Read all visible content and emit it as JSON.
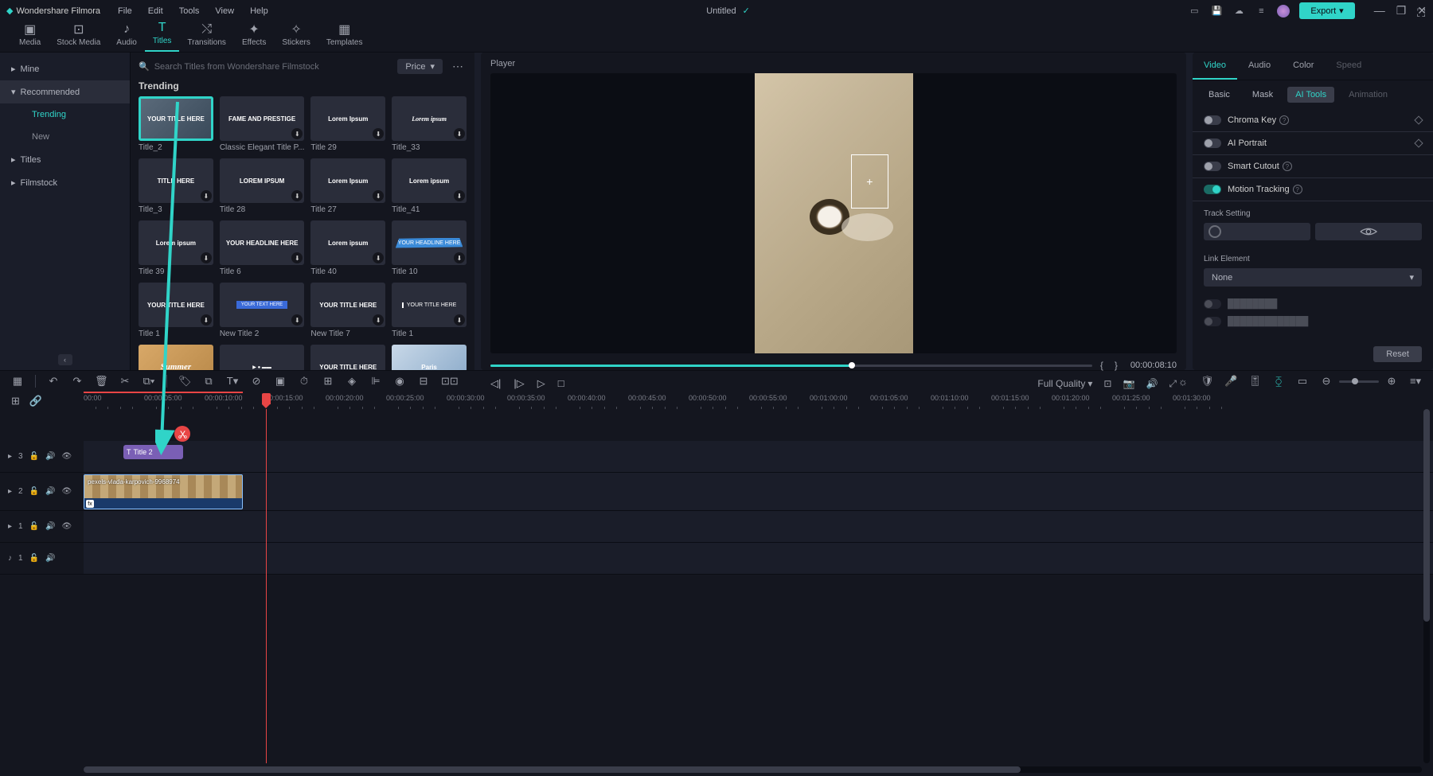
{
  "titlebar": {
    "brand": "Wondershare Filmora",
    "menus": [
      "File",
      "Edit",
      "Tools",
      "View",
      "Help"
    ],
    "document": "Untitled",
    "export": "Export"
  },
  "topnav": [
    "Media",
    "Stock Media",
    "Audio",
    "Titles",
    "Transitions",
    "Effects",
    "Stickers",
    "Templates"
  ],
  "topnav_active": 3,
  "sidebar": {
    "items": [
      {
        "label": "Mine",
        "type": "collapsible"
      },
      {
        "label": "Recommended",
        "type": "header"
      },
      {
        "label": "Trending",
        "type": "child",
        "active": true
      },
      {
        "label": "New",
        "type": "child"
      },
      {
        "label": "Titles",
        "type": "collapsible"
      },
      {
        "label": "Filmstock",
        "type": "collapsible"
      }
    ]
  },
  "browser": {
    "search_placeholder": "Search Titles from Wondershare Filmstock",
    "sort": "Price",
    "heading": "Trending",
    "cards": [
      {
        "thumb_text": "YOUR TITLE HERE",
        "label": "Title_2",
        "selected": true,
        "dark": false
      },
      {
        "thumb_text": "FAME AND PRESTIGE",
        "label": "Classic Elegant Title P...",
        "dark": true
      },
      {
        "thumb_text": "Lorem Ipsum",
        "label": "Title 29",
        "dark": true
      },
      {
        "thumb_text": "Lorem ipsum",
        "label": "Title_33",
        "dark": true,
        "italic": true
      },
      {
        "thumb_text": "TITLE HERE",
        "label": "Title_3",
        "dark": true
      },
      {
        "thumb_text": "LOREM IPSUM",
        "label": "Title 28",
        "dark": true
      },
      {
        "thumb_text": "Lorem Ipsum",
        "label": "Title 27",
        "dark": true
      },
      {
        "thumb_text": "Lorem ipsum",
        "label": "Title_41",
        "dark": true
      },
      {
        "thumb_text": "Lorem ipsum",
        "label": "Title 39",
        "dark": true
      },
      {
        "thumb_text": "YOUR HEADLINE HERE",
        "label": "Title 6",
        "dark": true,
        "align": "left"
      },
      {
        "thumb_text": "Lorem ipsum",
        "label": "Title 40",
        "dark": true
      },
      {
        "thumb_text": "YOUR HEADLINE HERE",
        "label": "Title 10",
        "dark": true,
        "splash": true
      },
      {
        "thumb_text": "YOUR TITLE HERE",
        "label": "Title 1",
        "dark": true
      },
      {
        "thumb_text": "YOUR TEXT HERE",
        "label": "New Title 2",
        "dark": true,
        "blue": true
      },
      {
        "thumb_text": "YOUR TITLE HERE",
        "label": "New Title 7",
        "dark": true
      },
      {
        "thumb_text": "YOUR TITLE HERE",
        "label": "Title 1",
        "dark": true,
        "bar": true
      },
      {
        "thumb_text": "Summer",
        "label": "",
        "dark": false,
        "script": true
      },
      {
        "thumb_text": "",
        "label": "",
        "dark": true,
        "youtube": true
      },
      {
        "thumb_text": "YOUR TITLE HERE",
        "label": "",
        "dark": true
      },
      {
        "thumb_text": "Paris",
        "label": "",
        "dark": false,
        "photo": true
      }
    ]
  },
  "player": {
    "title": "Player",
    "timecode": "00:00:08:10",
    "quality": "Full Quality"
  },
  "inspector": {
    "tabs1": [
      {
        "label": "Video",
        "state": "active"
      },
      {
        "label": "Audio",
        "state": ""
      },
      {
        "label": "Color",
        "state": ""
      },
      {
        "label": "Speed",
        "state": "disabled"
      }
    ],
    "tabs2": [
      {
        "label": "Basic",
        "state": ""
      },
      {
        "label": "Mask",
        "state": ""
      },
      {
        "label": "AI Tools",
        "state": "active"
      },
      {
        "label": "Animation",
        "state": "disabled"
      }
    ],
    "sections": [
      {
        "label": "Chroma Key",
        "on": false,
        "help": true,
        "diamond": true
      },
      {
        "label": "AI Portrait",
        "on": false,
        "help": false,
        "diamond": true
      },
      {
        "label": "Smart Cutout",
        "on": false,
        "help": true,
        "diamond": false
      },
      {
        "label": "Motion Tracking",
        "on": true,
        "help": true,
        "diamond": false
      }
    ],
    "track_setting_label": "Track Setting",
    "link_element_label": "Link Element",
    "link_element_value": "None",
    "reset": "Reset"
  },
  "timeline": {
    "ticks": [
      "00:00",
      "00:00:05:00",
      "00:00:10:00",
      "00:00:15:00",
      "00:00:20:00",
      "00:00:25:00",
      "00:00:30:00",
      "00:00:35:00",
      "00:00:40:00",
      "00:00:45:00",
      "00:00:50:00",
      "00:00:55:00",
      "00:01:00:00",
      "00:01:05:00",
      "00:01:10:00",
      "00:01:15:00",
      "00:01:20:00",
      "00:01:25:00",
      "00:01:30:00"
    ],
    "tracks": [
      {
        "id": "3",
        "type": "video"
      },
      {
        "id": "2",
        "type": "video"
      },
      {
        "id": "1",
        "type": "video"
      },
      {
        "id": "1",
        "type": "audio"
      }
    ],
    "title_clip": "Title 2",
    "video_clip": "pexels-vlada-karpovich-9968974"
  }
}
